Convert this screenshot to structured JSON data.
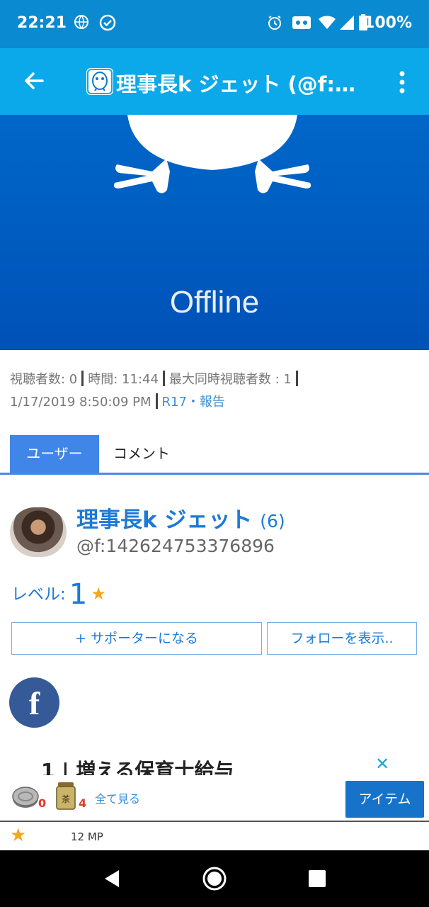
{
  "status_bar": {
    "time": "22:21",
    "battery": "100%",
    "icons": [
      "vpn-globe-icon",
      "check-circle-icon",
      "alarm-icon",
      "cast-icon",
      "wifi-icon",
      "signal-icon",
      "battery-icon"
    ]
  },
  "app_bar": {
    "title": "理事長k ジェット (@f:理…",
    "back_icon": "arrow-left-icon",
    "menu_icon": "more-vert-icon",
    "color": "#0ba9ea"
  },
  "video": {
    "state_text": "Offline",
    "color": "#0058bf"
  },
  "stats": {
    "viewers": "視聴者数: 0",
    "duration": "時間: 11:44",
    "max_concurrent": "最大同時視聴者数 : 1",
    "date": "1/17/2019 8:50:09 PM",
    "rating_report": "R17・報告"
  },
  "tabs": [
    {
      "label": "ユーザー",
      "active": true
    },
    {
      "label": "コメント",
      "active": false
    }
  ],
  "profile": {
    "name": "理事長k ジェット",
    "count": "(6)",
    "handle": "@f:142624753376896",
    "level_label": "レベル:",
    "level_value": "1",
    "support_button": "+ サポーターになる",
    "follow_button": "フォローを表示..",
    "social_icon": "facebook-icon"
  },
  "ad": {
    "text": "1 | 増える保育士給与",
    "close_icon": "close-icon"
  },
  "item_bar": {
    "coin_count": "0",
    "tea_count": "4",
    "see_all": "全て見る",
    "item_button": "アイテム",
    "tea_label": "茶"
  },
  "mp_row": {
    "text": "12 MP"
  },
  "accent_color": "#1c7ad8",
  "star_color": "#f3a71d"
}
